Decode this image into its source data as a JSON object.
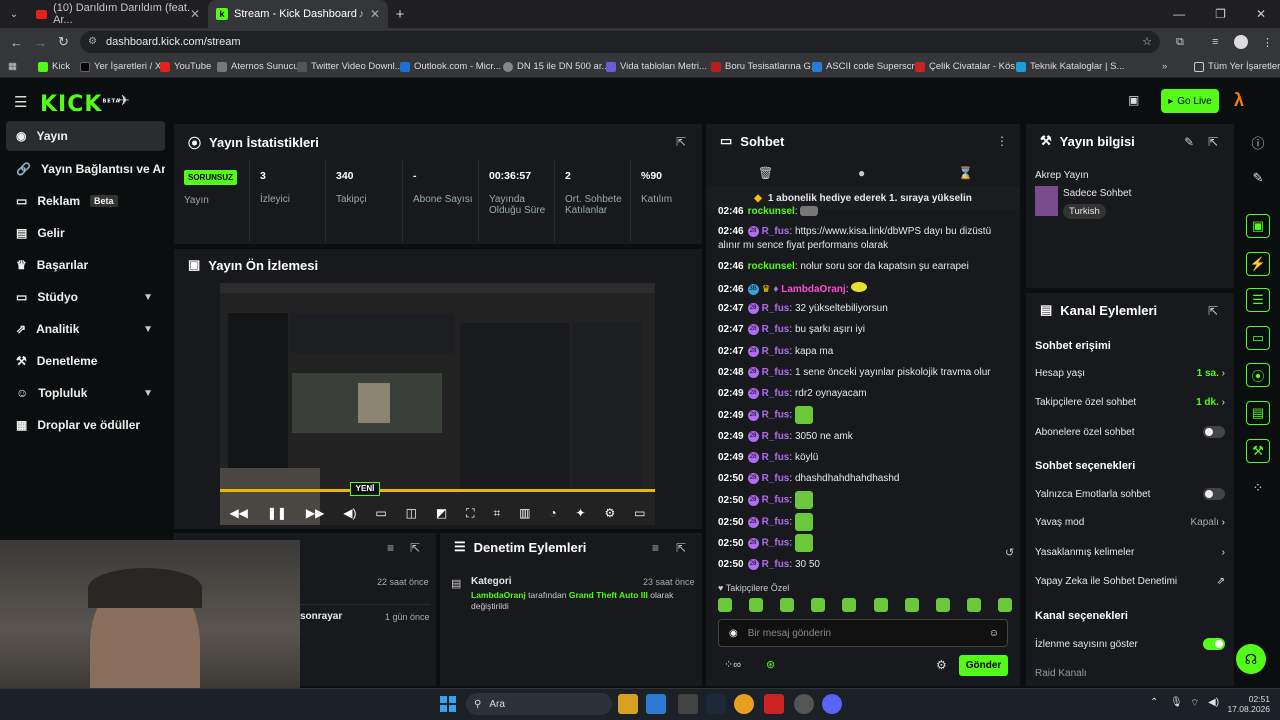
{
  "browser": {
    "tabs": [
      {
        "title": "(10) Darıldım Darıldım (feat. Ar..."
      },
      {
        "title": "Stream - Kick Dashboard"
      }
    ],
    "url": "dashboard.kick.com/stream",
    "bookmarks": [
      "Kick",
      "Yer İşaretleri / X",
      "YouTube",
      "Aternos Sunucu",
      "Twitter Video Downl...",
      "Outlook.com - Micr...",
      "DN 15 ile DN 500 ar...",
      "Vida tabloları Metri...",
      "Boru Tesisatlarına G...",
      "ASCII code Superscr...",
      "Çelik Civatalar - Kös...",
      "Teknik Kataloglar | S..."
    ],
    "all_bookmarks": "Tüm Yer İşaretleri"
  },
  "kick": {
    "logo": "KICK",
    "beta": "BETA",
    "go_live": "Go Live"
  },
  "sidebar": {
    "items": [
      {
        "label": "Yayın"
      },
      {
        "label": "Yayın Bağlantısı ve Anahtarı"
      },
      {
        "label": "Reklam",
        "badge": "Beta"
      },
      {
        "label": "Gelir"
      },
      {
        "label": "Başarılar"
      },
      {
        "label": "Stüdyo"
      },
      {
        "label": "Analitik"
      },
      {
        "label": "Denetleme"
      },
      {
        "label": "Topluluk"
      },
      {
        "label": "Droplar ve ödüller"
      }
    ]
  },
  "stats": {
    "title": "Yayın İstatistikleri",
    "status": "SORUNSUZ",
    "status_label": "Yayın",
    "items": [
      {
        "value": "3",
        "label": "İzleyici"
      },
      {
        "value": "340",
        "label": "Takipçi"
      },
      {
        "value": "-",
        "label": "Abone Sayısı"
      },
      {
        "value": "00:36:57",
        "label": "Yayında Olduğu Süre"
      },
      {
        "value": "2",
        "label": "Ort. Sohbete Katılanlar"
      },
      {
        "value": "%90",
        "label": "Katılım"
      }
    ]
  },
  "preview": {
    "title": "Yayın Ön İzlemesi",
    "new_label": "YENİ"
  },
  "activity": {
    "row1_time": "22 saat önce",
    "row2_user": "sonrayar",
    "row2_time": "1 gün önce"
  },
  "moderation": {
    "title": "Denetim Eylemleri",
    "item_title": "Kategori",
    "item_time": "23 saat önce",
    "user": "LambdaOranj",
    "text1": "tarafından",
    "game": "Grand Theft Auto III",
    "text2": "olarak değiştirildi"
  },
  "chat": {
    "title": "Sohbet",
    "banner": "1 abonelik hediye ederek 1. sıraya yükselin",
    "messages": [
      {
        "time": "02:46",
        "user": "rockunsel",
        "text": ""
      },
      {
        "time": "02:46",
        "user": "R_fus",
        "text": "https://www.kisa.link/dbWPS dayı bu dizüstü",
        "text2": "alınır mı sence fiyat performans olarak"
      },
      {
        "time": "02:46",
        "user": "rockunsel",
        "text": "nolur soru sor da kapatsın şu earrapei"
      },
      {
        "time": "02:46",
        "user": "LambdaOranj",
        "text": ""
      },
      {
        "time": "02:47",
        "user": "R_fus",
        "text": "32 yükseltebiliyorsun"
      },
      {
        "time": "02:47",
        "user": "R_fus",
        "text": "bu şarkı aşırı iyi"
      },
      {
        "time": "02:47",
        "user": "R_fus",
        "text": "kapa ma"
      },
      {
        "time": "02:48",
        "user": "R_fus",
        "text": "1 sene önceki yayınlar piskolojik travma olur"
      },
      {
        "time": "02:49",
        "user": "R_fus",
        "text": "rdr2 oynayacam"
      },
      {
        "time": "02:49",
        "user": "R_fus",
        "text": ""
      },
      {
        "time": "02:49",
        "user": "R_fus",
        "text": "3050 ne amk"
      },
      {
        "time": "02:49",
        "user": "R_fus",
        "text": "köylü"
      },
      {
        "time": "02:50",
        "user": "R_fus",
        "text": "dhashdhahdhahdhashd"
      },
      {
        "time": "02:50",
        "user": "R_fus",
        "text": ""
      },
      {
        "time": "02:50",
        "user": "R_fus",
        "text": ""
      },
      {
        "time": "02:50",
        "user": "R_fus",
        "text": ""
      },
      {
        "time": "02:50",
        "user": "R_fus",
        "text": "30 50"
      }
    ],
    "followers_only": "Takipçilere Özel",
    "input_placeholder": "Bir mesaj gönderin",
    "send": "Gönder"
  },
  "stream_info": {
    "title": "Yayın bilgisi",
    "stream_title": "Akrep Yayın",
    "category": "Sadece Sohbet",
    "tag": "Turkish"
  },
  "channel_actions": {
    "title": "Kanal Eylemleri",
    "chat_access": "Sohbet erişimi",
    "account_age": "Hesap yaşı",
    "account_age_val": "1 sa.",
    "followers_only": "Takipçilere özel sohbet",
    "followers_only_val": "1 dk.",
    "subs_only": "Abonelere özel sohbet",
    "chat_options": "Sohbet seçenekleri",
    "emote_only": "Yalnızca Emotlarla sohbet",
    "slow_mode": "Yavaş mod",
    "slow_mode_val": "Kapalı",
    "banned_words": "Yasaklanmış kelimeler",
    "ai_mod": "Yapay Zeka ile Sohbet Denetimi",
    "channel_options": "Kanal seçenekleri",
    "show_viewers": "İzlenme sayısını göster",
    "raid": "Raid Kanalı"
  },
  "taskbar": {
    "search": "Ara",
    "time": "02:51",
    "date": "17.08.2026"
  }
}
